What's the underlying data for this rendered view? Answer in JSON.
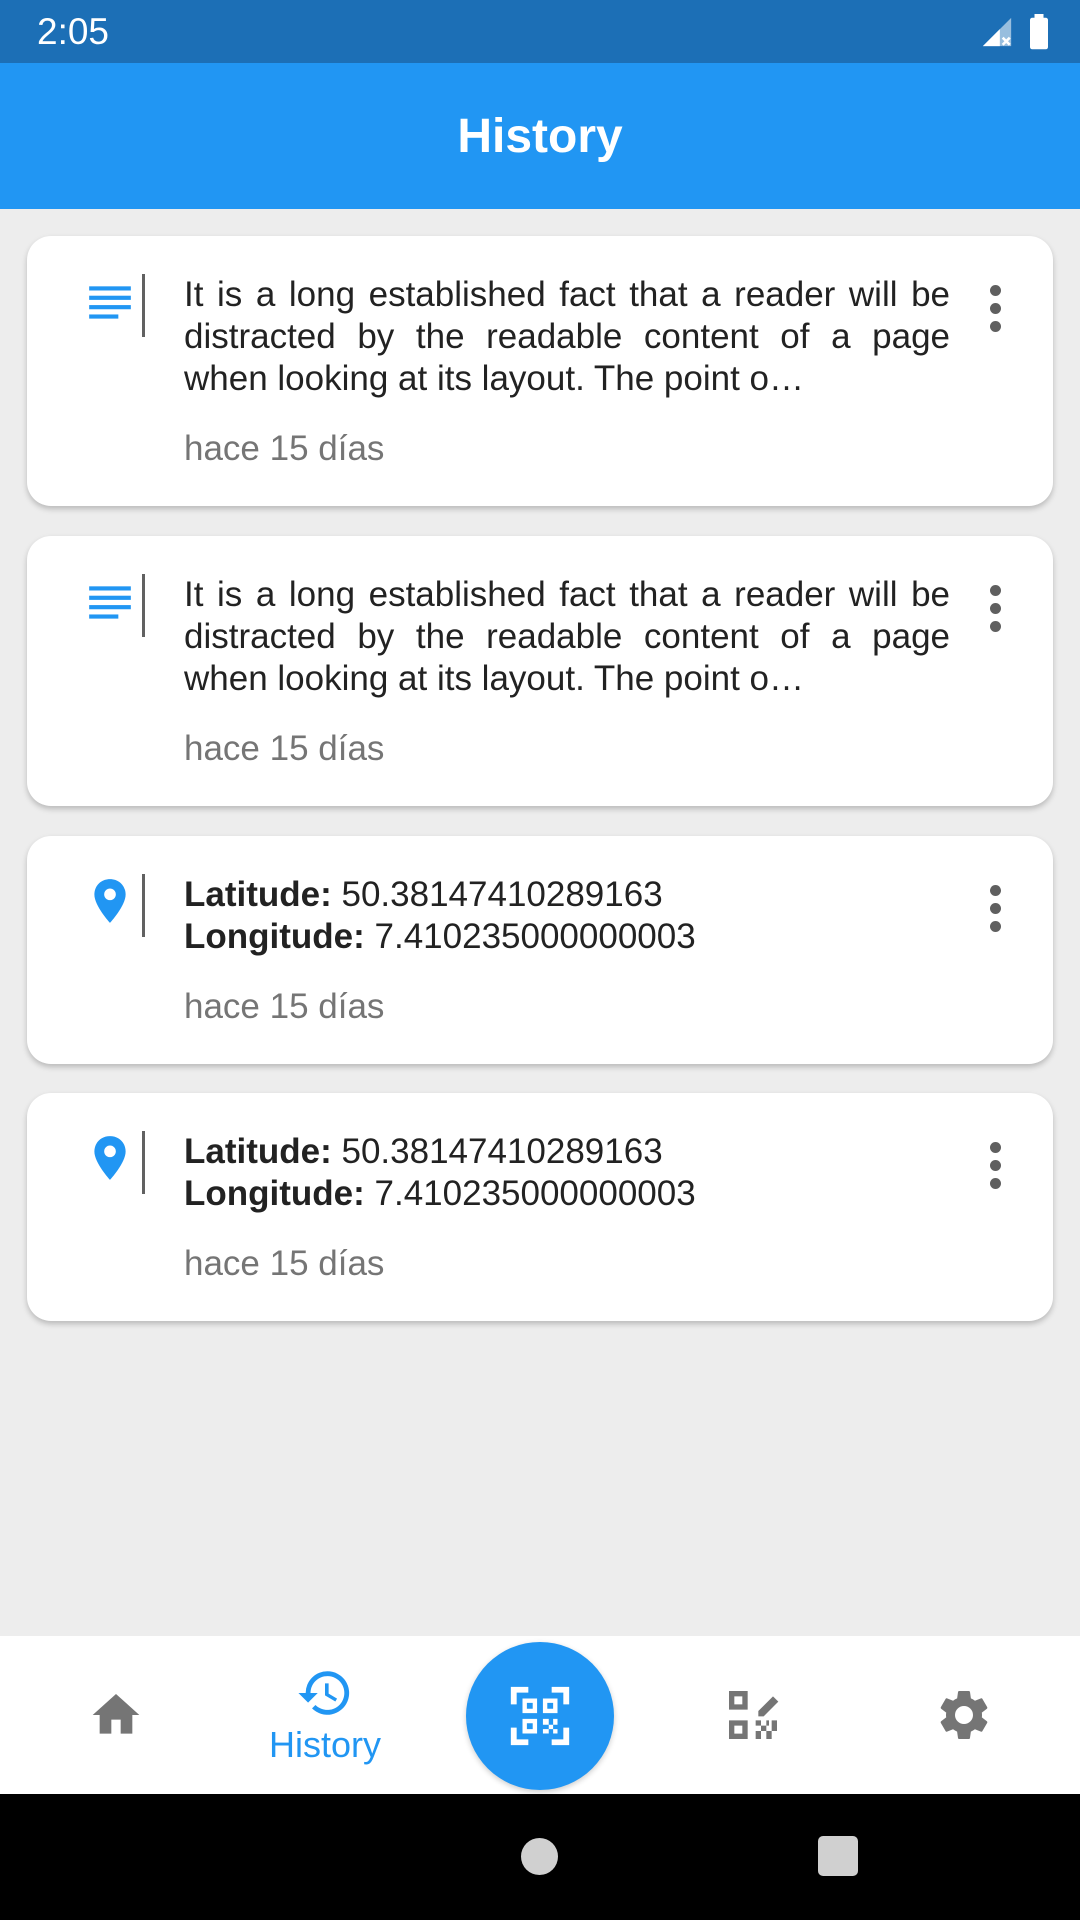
{
  "status_bar": {
    "time": "2:05",
    "signal_icon": "signal-off-icon",
    "battery_icon": "battery-full-icon"
  },
  "app_bar": {
    "title": "History"
  },
  "colors": {
    "primary": "#2196f3",
    "status_bar": "#1c6fb6",
    "background": "#ededed"
  },
  "history": [
    {
      "type": "text",
      "icon": "text-lines-icon",
      "text": "It is a long established fact that a reader will be distracted by the readable content of a page when looking at its layout. The point o…",
      "time": "hace 15 días"
    },
    {
      "type": "text",
      "icon": "text-lines-icon",
      "text": "It is a long established fact that a reader will be distracted by the readable content of a page when looking at its layout. The point o…",
      "time": "hace 15 días"
    },
    {
      "type": "location",
      "icon": "location-pin-icon",
      "latitude_label": "Latitude:",
      "latitude": "50.38147410289163",
      "longitude_label": "Longitude:",
      "longitude": "7.410235000000003",
      "time": "hace 15 días"
    },
    {
      "type": "location",
      "icon": "location-pin-icon",
      "latitude_label": "Latitude:",
      "latitude": "50.38147410289163",
      "longitude_label": "Longitude:",
      "longitude": "7.410235000000003",
      "time": "hace 15 días"
    }
  ],
  "bottom_nav": {
    "items": [
      {
        "icon": "home-icon",
        "label": ""
      },
      {
        "icon": "history-icon",
        "label": "History",
        "active": true
      },
      {
        "icon": "qr-scan-icon",
        "label": ""
      },
      {
        "icon": "qr-edit-icon",
        "label": ""
      },
      {
        "icon": "settings-gear-icon",
        "label": ""
      }
    ]
  }
}
